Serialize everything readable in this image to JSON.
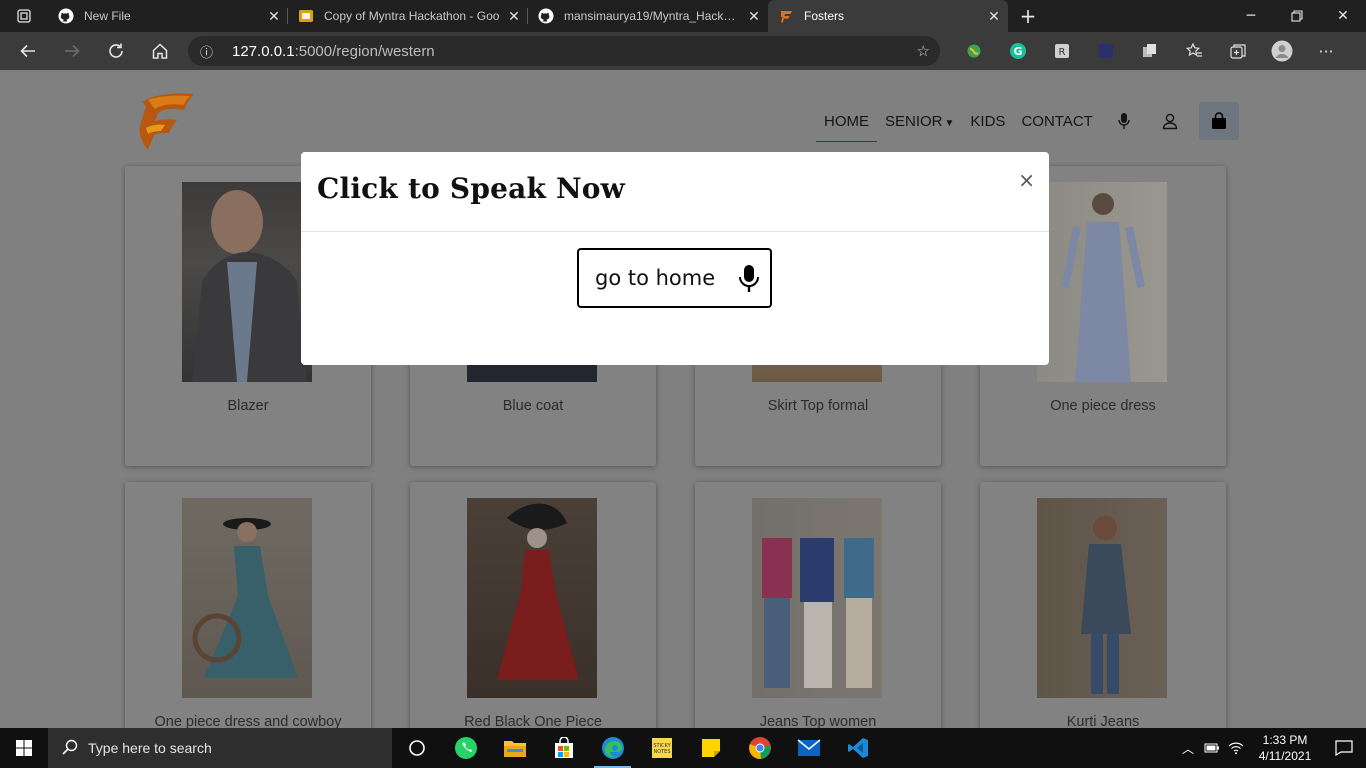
{
  "browser": {
    "tabs": [
      {
        "title": "New File",
        "icon": "github-icon"
      },
      {
        "title": "Copy of Myntra Hackathon - Goo",
        "icon": "slides-icon"
      },
      {
        "title": "mansimaurya19/Myntra_Hackath",
        "icon": "github-icon"
      },
      {
        "title": "Fosters",
        "icon": "fosters-icon",
        "active": true
      }
    ],
    "url_host": "127.0.0.1",
    "url_rest": ":5000/region/western"
  },
  "site": {
    "nav": {
      "home": "HOME",
      "senior": "SENIOR",
      "kids": "KIDS",
      "contact": "CONTACT"
    },
    "products": [
      {
        "name": "Blazer",
        "color": "#4a4a4a"
      },
      {
        "name": "Blue coat",
        "color": "#262b36"
      },
      {
        "name": "Skirt Top formal",
        "color": "#6b5a47"
      },
      {
        "name": "One piece dress",
        "color": "#7a8494"
      },
      {
        "name": "One piece dress and cowboy",
        "color": "#4d6b6b"
      },
      {
        "name": "Red Black One Piece",
        "color": "#5a3a35"
      },
      {
        "name": "Jeans Top women",
        "color": "#6f6a5e"
      },
      {
        "name": "Kurti Jeans",
        "color": "#5e5448"
      }
    ]
  },
  "modal": {
    "title": "Click to Speak Now",
    "close": "×",
    "voice_text": "go to home"
  },
  "taskbar": {
    "search_placeholder": "Type here to search",
    "time": "1:33 PM",
    "date": "4/11/2021"
  }
}
